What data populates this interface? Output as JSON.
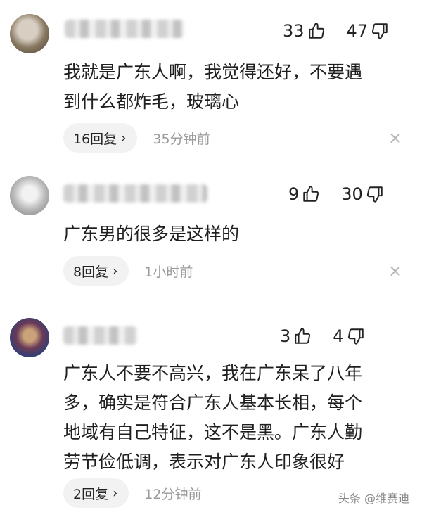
{
  "comments": [
    {
      "likes": "33",
      "dislikes": "47",
      "text_lines": [
        "我就是广东人啊，我觉得还好，不要遇",
        "到什么都炸毛，玻璃心"
      ],
      "replies_label": "16回复",
      "time": "35分钟前"
    },
    {
      "likes": "9",
      "dislikes": "30",
      "text_lines": [
        "广东男的很多是这样的"
      ],
      "replies_label": "8回复",
      "time": "1小时前"
    },
    {
      "likes": "3",
      "dislikes": "4",
      "text_lines": [
        "广东人不要不高兴，我在广东呆了八年",
        "多，确实是符合广东人基本长相，每个",
        "地域有自己特征，这不是黑。广东人勤",
        "劳节俭低调，表示对广东人印象很好"
      ],
      "replies_label": "2回复",
      "time": "12分钟前"
    }
  ],
  "icons": {
    "like": "thumbs-up-icon",
    "dislike": "thumbs-down-icon",
    "chevron": "chevron-right-icon",
    "close": "close-icon"
  },
  "labels": {
    "chevron_glyph": "›",
    "close_glyph": "×"
  },
  "watermark": "头条 @维赛迪"
}
